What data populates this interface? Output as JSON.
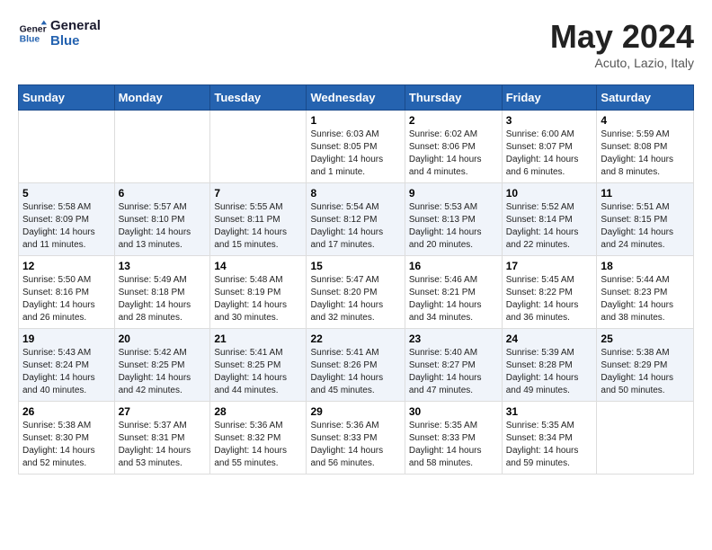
{
  "header": {
    "logo_line1": "General",
    "logo_line2": "Blue",
    "month": "May 2024",
    "location": "Acuto, Lazio, Italy"
  },
  "weekdays": [
    "Sunday",
    "Monday",
    "Tuesday",
    "Wednesday",
    "Thursday",
    "Friday",
    "Saturday"
  ],
  "weeks": [
    [
      {
        "day": "",
        "info": ""
      },
      {
        "day": "",
        "info": ""
      },
      {
        "day": "",
        "info": ""
      },
      {
        "day": "1",
        "info": "Sunrise: 6:03 AM\nSunset: 8:05 PM\nDaylight: 14 hours\nand 1 minute."
      },
      {
        "day": "2",
        "info": "Sunrise: 6:02 AM\nSunset: 8:06 PM\nDaylight: 14 hours\nand 4 minutes."
      },
      {
        "day": "3",
        "info": "Sunrise: 6:00 AM\nSunset: 8:07 PM\nDaylight: 14 hours\nand 6 minutes."
      },
      {
        "day": "4",
        "info": "Sunrise: 5:59 AM\nSunset: 8:08 PM\nDaylight: 14 hours\nand 8 minutes."
      }
    ],
    [
      {
        "day": "5",
        "info": "Sunrise: 5:58 AM\nSunset: 8:09 PM\nDaylight: 14 hours\nand 11 minutes."
      },
      {
        "day": "6",
        "info": "Sunrise: 5:57 AM\nSunset: 8:10 PM\nDaylight: 14 hours\nand 13 minutes."
      },
      {
        "day": "7",
        "info": "Sunrise: 5:55 AM\nSunset: 8:11 PM\nDaylight: 14 hours\nand 15 minutes."
      },
      {
        "day": "8",
        "info": "Sunrise: 5:54 AM\nSunset: 8:12 PM\nDaylight: 14 hours\nand 17 minutes."
      },
      {
        "day": "9",
        "info": "Sunrise: 5:53 AM\nSunset: 8:13 PM\nDaylight: 14 hours\nand 20 minutes."
      },
      {
        "day": "10",
        "info": "Sunrise: 5:52 AM\nSunset: 8:14 PM\nDaylight: 14 hours\nand 22 minutes."
      },
      {
        "day": "11",
        "info": "Sunrise: 5:51 AM\nSunset: 8:15 PM\nDaylight: 14 hours\nand 24 minutes."
      }
    ],
    [
      {
        "day": "12",
        "info": "Sunrise: 5:50 AM\nSunset: 8:16 PM\nDaylight: 14 hours\nand 26 minutes."
      },
      {
        "day": "13",
        "info": "Sunrise: 5:49 AM\nSunset: 8:18 PM\nDaylight: 14 hours\nand 28 minutes."
      },
      {
        "day": "14",
        "info": "Sunrise: 5:48 AM\nSunset: 8:19 PM\nDaylight: 14 hours\nand 30 minutes."
      },
      {
        "day": "15",
        "info": "Sunrise: 5:47 AM\nSunset: 8:20 PM\nDaylight: 14 hours\nand 32 minutes."
      },
      {
        "day": "16",
        "info": "Sunrise: 5:46 AM\nSunset: 8:21 PM\nDaylight: 14 hours\nand 34 minutes."
      },
      {
        "day": "17",
        "info": "Sunrise: 5:45 AM\nSunset: 8:22 PM\nDaylight: 14 hours\nand 36 minutes."
      },
      {
        "day": "18",
        "info": "Sunrise: 5:44 AM\nSunset: 8:23 PM\nDaylight: 14 hours\nand 38 minutes."
      }
    ],
    [
      {
        "day": "19",
        "info": "Sunrise: 5:43 AM\nSunset: 8:24 PM\nDaylight: 14 hours\nand 40 minutes."
      },
      {
        "day": "20",
        "info": "Sunrise: 5:42 AM\nSunset: 8:25 PM\nDaylight: 14 hours\nand 42 minutes."
      },
      {
        "day": "21",
        "info": "Sunrise: 5:41 AM\nSunset: 8:25 PM\nDaylight: 14 hours\nand 44 minutes."
      },
      {
        "day": "22",
        "info": "Sunrise: 5:41 AM\nSunset: 8:26 PM\nDaylight: 14 hours\nand 45 minutes."
      },
      {
        "day": "23",
        "info": "Sunrise: 5:40 AM\nSunset: 8:27 PM\nDaylight: 14 hours\nand 47 minutes."
      },
      {
        "day": "24",
        "info": "Sunrise: 5:39 AM\nSunset: 8:28 PM\nDaylight: 14 hours\nand 49 minutes."
      },
      {
        "day": "25",
        "info": "Sunrise: 5:38 AM\nSunset: 8:29 PM\nDaylight: 14 hours\nand 50 minutes."
      }
    ],
    [
      {
        "day": "26",
        "info": "Sunrise: 5:38 AM\nSunset: 8:30 PM\nDaylight: 14 hours\nand 52 minutes."
      },
      {
        "day": "27",
        "info": "Sunrise: 5:37 AM\nSunset: 8:31 PM\nDaylight: 14 hours\nand 53 minutes."
      },
      {
        "day": "28",
        "info": "Sunrise: 5:36 AM\nSunset: 8:32 PM\nDaylight: 14 hours\nand 55 minutes."
      },
      {
        "day": "29",
        "info": "Sunrise: 5:36 AM\nSunset: 8:33 PM\nDaylight: 14 hours\nand 56 minutes."
      },
      {
        "day": "30",
        "info": "Sunrise: 5:35 AM\nSunset: 8:33 PM\nDaylight: 14 hours\nand 58 minutes."
      },
      {
        "day": "31",
        "info": "Sunrise: 5:35 AM\nSunset: 8:34 PM\nDaylight: 14 hours\nand 59 minutes."
      },
      {
        "day": "",
        "info": ""
      }
    ]
  ]
}
